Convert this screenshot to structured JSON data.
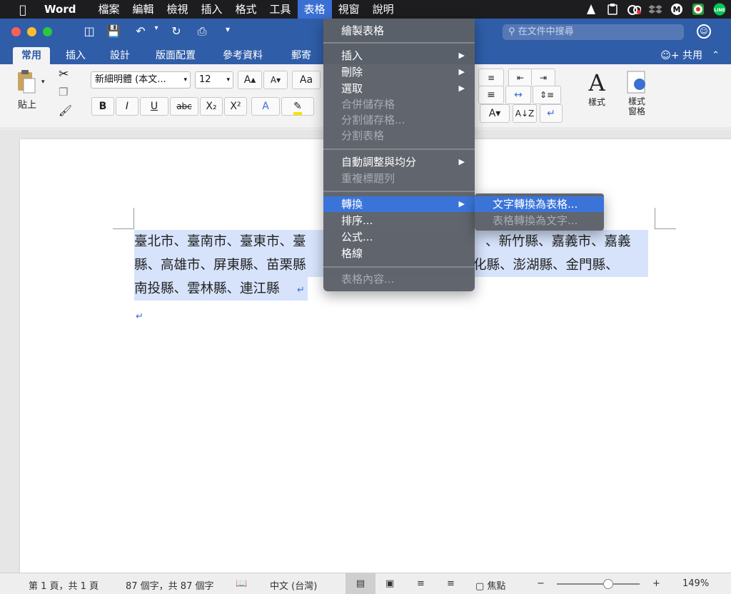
{
  "menubar": {
    "app_name": "Word",
    "items": [
      "檔案",
      "編輯",
      "檢視",
      "插入",
      "格式",
      "工具",
      "表格",
      "視窗",
      "說明"
    ],
    "active_item": "表格"
  },
  "window": {
    "search_placeholder": "在文件中搜尋",
    "tabs": [
      "常用",
      "插入",
      "設計",
      "版面配置",
      "參考資料",
      "郵寄"
    ],
    "active_tab": "常用",
    "share_label": "共用"
  },
  "ribbon": {
    "paste_label": "貼上",
    "font_name": "新細明體 (本文...",
    "font_size": "12",
    "styles_label": "樣式",
    "styles_pane_label": "樣式窗格"
  },
  "document": {
    "line1": "臺北市、臺南市、臺東市、臺",
    "line1_right": "、新竹縣、嘉義市、嘉義",
    "line2": "縣、高雄市、屏東縣、苗栗縣",
    "line2_right": "化縣、澎湖縣、金門縣、",
    "line3": "南投縣、雲林縣、連江縣"
  },
  "table_menu": {
    "items": [
      {
        "label": "繪製表格",
        "enabled": true
      },
      {
        "label": "插入",
        "enabled": true,
        "submenu": true
      },
      {
        "label": "刪除",
        "enabled": true,
        "submenu": true
      },
      {
        "label": "選取",
        "enabled": true,
        "submenu": true
      },
      {
        "label": "合併儲存格",
        "enabled": false
      },
      {
        "label": "分割儲存格...",
        "enabled": false
      },
      {
        "label": "分割表格",
        "enabled": false
      },
      {
        "label": "自動調整與均分",
        "enabled": true,
        "submenu": true
      },
      {
        "label": "重複標題列",
        "enabled": false
      },
      {
        "label": "轉換",
        "enabled": true,
        "submenu": true,
        "highlighted": true
      },
      {
        "label": "排序...",
        "enabled": true
      },
      {
        "label": "公式...",
        "enabled": true
      },
      {
        "label": "格線",
        "enabled": true
      },
      {
        "label": "表格內容...",
        "enabled": false
      }
    ]
  },
  "convert_submenu": {
    "items": [
      {
        "label": "文字轉換為表格...",
        "enabled": true
      },
      {
        "label": "表格轉換為文字...",
        "enabled": false
      }
    ]
  },
  "statusbar": {
    "page": "第 1 頁，共 1 頁",
    "words": "87 個字，共 87 個字",
    "language": "中文 (台灣)",
    "focus": "焦點",
    "zoom": "149%",
    "zoom_level": 0.62
  },
  "colors": {
    "title_blue": "#2f5da8",
    "menu_highlight": "#3b74d9",
    "selection": "#d6e3fb"
  }
}
